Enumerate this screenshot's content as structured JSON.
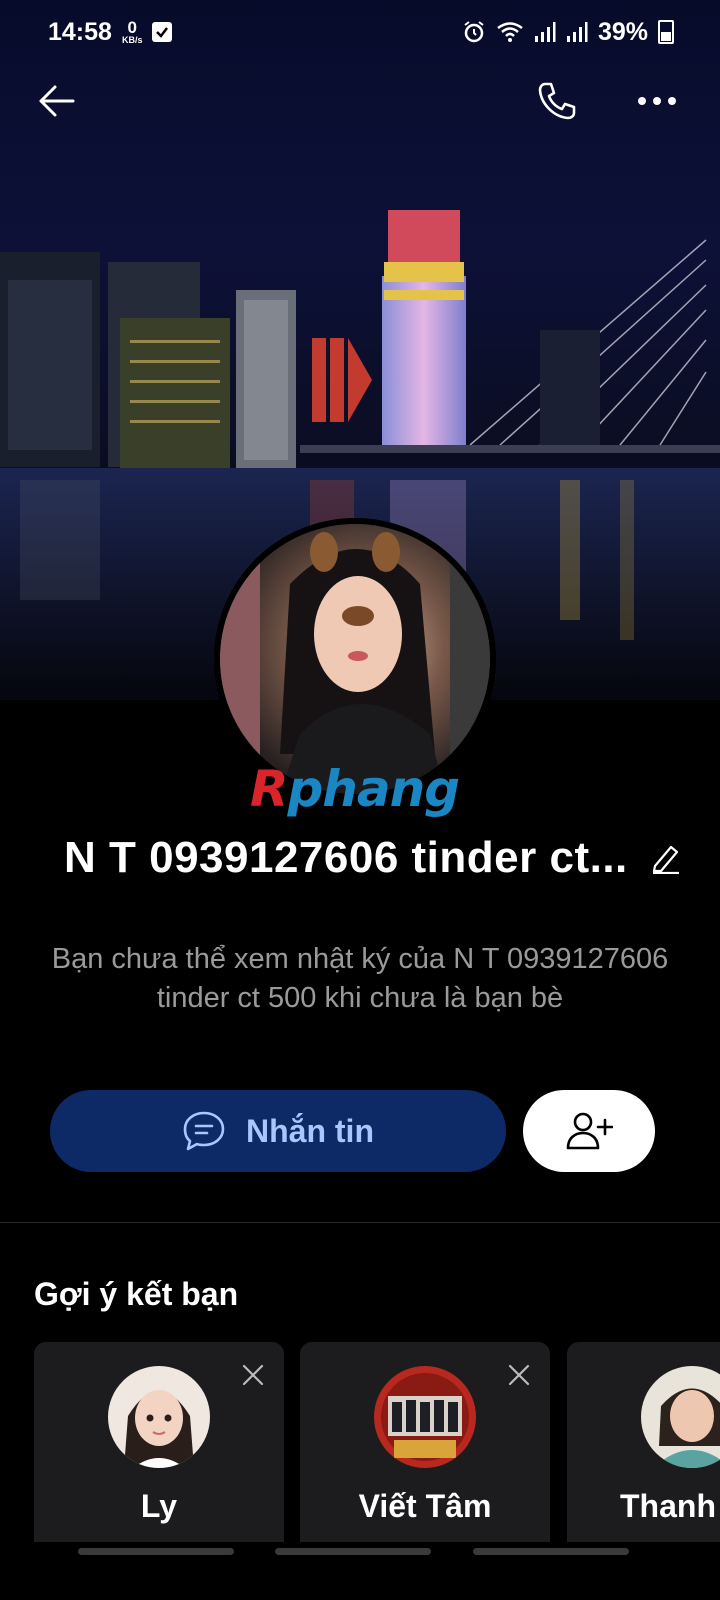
{
  "status_bar": {
    "time": "14:58",
    "net_speed_value": "0",
    "net_speed_unit": "KB/s",
    "battery": "39%"
  },
  "nav": {
    "back_icon": "arrow-left-icon",
    "call_icon": "phone-icon",
    "more_icon": "more-dots-icon"
  },
  "profile": {
    "name": "N T  0939127606 tinder ct...",
    "notice": "Bạn chưa thể xem nhật ký của N T 0939127606 tinder ct 500 khi chưa là bạn bè",
    "watermark_first": "R",
    "watermark_rest": "phang"
  },
  "actions": {
    "message_label": "Nhắn tin",
    "add_friend_icon": "add-friend-icon"
  },
  "suggestions": {
    "title": "Gợi ý kết bạn",
    "cards": [
      {
        "name": "Ly"
      },
      {
        "name": "Viết Tâm"
      },
      {
        "name": "Thanh"
      }
    ]
  },
  "colors": {
    "message_button_bg": "#0d2a66",
    "message_button_text": "#a8c7ff",
    "notice_text": "#9a9a9a"
  }
}
